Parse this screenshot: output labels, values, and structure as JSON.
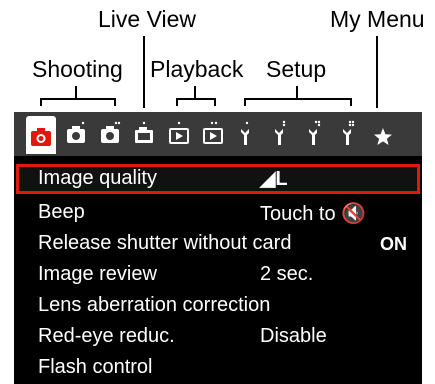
{
  "callouts": {
    "shooting": "Shooting",
    "live_view": "Live View",
    "playback": "Playback",
    "setup": "Setup",
    "my_menu": "My Menu"
  },
  "tabs": [
    {
      "icon": "camera-icon",
      "active": true
    },
    {
      "icon": "camera-icon"
    },
    {
      "icon": "camera-icon"
    },
    {
      "icon": "live-view-icon"
    },
    {
      "icon": "playback-icon"
    },
    {
      "icon": "playback-icon"
    },
    {
      "icon": "wrench-icon"
    },
    {
      "icon": "wrench-icon"
    },
    {
      "icon": "wrench-icon"
    },
    {
      "icon": "wrench-icon"
    },
    {
      "icon": "star-icon"
    }
  ],
  "menu": {
    "items": [
      {
        "label": "Image quality",
        "value": "◢L",
        "selected": true
      },
      {
        "label": "Beep",
        "value": "Touch to 🔇"
      },
      {
        "label": "Release shutter without card",
        "value": "ON"
      },
      {
        "label": "Image review",
        "value": "2 sec."
      },
      {
        "label": "Lens aberration correction",
        "value": ""
      },
      {
        "label": "Red-eye reduc.",
        "value": "Disable"
      },
      {
        "label": "Flash control",
        "value": ""
      }
    ]
  },
  "colors": {
    "active_tab": "#e0190e",
    "highlight_border": "#e0190e",
    "tabbar": "#3a3a3a",
    "background": "#000000"
  }
}
